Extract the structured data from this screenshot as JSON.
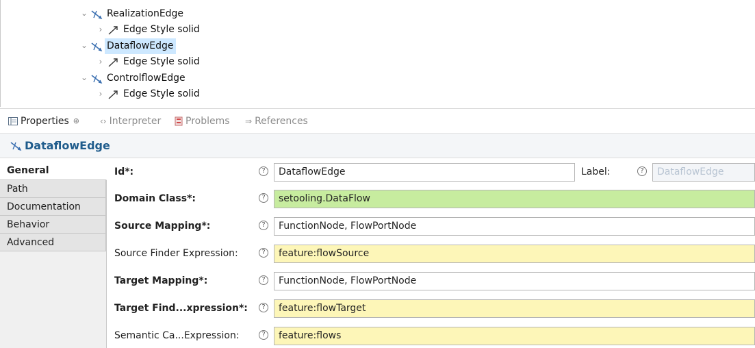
{
  "tree": {
    "items": [
      {
        "label": "RealizationEdge",
        "level": 0,
        "expanded": true,
        "icon": "edge-mapping-icon",
        "selected": false
      },
      {
        "label": "Edge Style solid",
        "level": 1,
        "expanded": false,
        "icon": "edge-style-icon",
        "selected": false
      },
      {
        "label": "DataflowEdge",
        "level": 0,
        "expanded": true,
        "icon": "edge-mapping-icon",
        "selected": true
      },
      {
        "label": "Edge Style solid",
        "level": 1,
        "expanded": false,
        "icon": "edge-style-icon",
        "selected": false
      },
      {
        "label": "ControlflowEdge",
        "level": 0,
        "expanded": true,
        "icon": "edge-mapping-icon",
        "selected": false
      },
      {
        "label": "Edge Style solid",
        "level": 1,
        "expanded": false,
        "icon": "edge-style-icon",
        "selected": false
      }
    ]
  },
  "view_tabs": [
    {
      "label": "Properties",
      "active": true,
      "icon": "properties-icon",
      "closable": true
    },
    {
      "label": "Interpreter",
      "active": false,
      "icon": "interpreter-icon"
    },
    {
      "label": "Problems",
      "active": false,
      "icon": "problems-icon"
    },
    {
      "label": "References",
      "active": false,
      "icon": "references-icon"
    }
  ],
  "properties": {
    "title": "DataflowEdge",
    "title_icon": "edge-mapping-icon",
    "side_tabs": [
      "General",
      "Path",
      "Documentation",
      "Behavior",
      "Advanced"
    ],
    "active_side_tab": "General",
    "fields": [
      {
        "label": "Id*:",
        "bold": true,
        "value": "DataflowEdge",
        "style": "white"
      },
      {
        "label": "Domain Class*:",
        "bold": true,
        "value": "setooling.DataFlow",
        "style": "green"
      },
      {
        "label": "Source Mapping*:",
        "bold": true,
        "value": "FunctionNode, FlowPortNode",
        "style": "white"
      },
      {
        "label": "Source Finder Expression:",
        "bold": false,
        "value": "feature:flowSource",
        "style": "yellow"
      },
      {
        "label": "Target Mapping*:",
        "bold": true,
        "value": "FunctionNode, FlowPortNode",
        "style": "white"
      },
      {
        "label": "Target Find...xpression*:",
        "bold": true,
        "value": "feature:flowTarget",
        "style": "yellow"
      },
      {
        "label": "Semantic Ca...Expression:",
        "bold": false,
        "value": "feature:flows",
        "style": "yellow"
      }
    ],
    "label_field": {
      "label": "Label:",
      "value": "DataflowEdge",
      "disabled": true
    }
  },
  "colors": {
    "selection": "#cde8ff",
    "title_blue": "#1f5c8c",
    "green_field": "#c7ec9f",
    "yellow_field": "#fdf6b8"
  }
}
